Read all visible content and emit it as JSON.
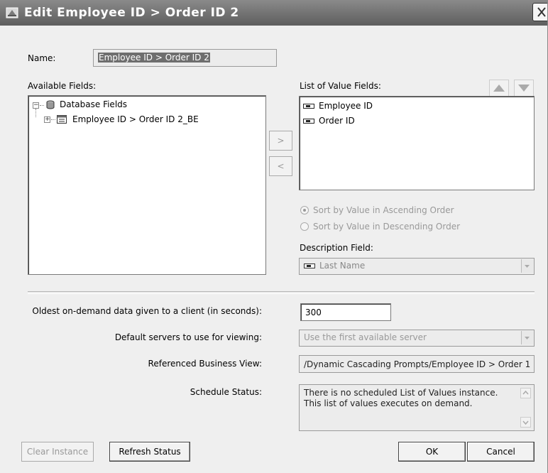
{
  "window": {
    "title": "Edit Employee ID > Order ID 2"
  },
  "name_label": "Name:",
  "name_value": "Employee ID > Order ID 2",
  "available_fields": {
    "label": "Available Fields:",
    "tree": [
      {
        "label": "Database Fields",
        "icon": "database-icon",
        "expander": "−"
      },
      {
        "label": "Employee ID > Order ID 2_BE",
        "icon": "table-icon",
        "expander": "+"
      }
    ]
  },
  "move_buttons": {
    "add": ">",
    "remove": "<"
  },
  "value_fields": {
    "label": "List of Value Fields:",
    "items": [
      "Employee ID",
      "Order ID"
    ],
    "up_icon": "arrow-up-icon",
    "down_icon": "arrow-down-icon"
  },
  "sort": {
    "ascending": "Sort by Value in Ascending Order",
    "descending": "Sort by Value in Descending Order",
    "selected": "ascending"
  },
  "description": {
    "label": "Description Field:",
    "value": "Last Name"
  },
  "settings": {
    "oldest_label": "Oldest on-demand data given to a client (in seconds):",
    "oldest_value": "300",
    "servers_label": "Default servers to use for viewing:",
    "servers_value": "Use the first available server",
    "business_view_label": "Referenced Business View:",
    "business_view_value": "/Dynamic Cascading Prompts/Employee ID > Order 1",
    "schedule_label": "Schedule Status:",
    "schedule_value": "There is no scheduled List of Values instance. This list of values executes on demand."
  },
  "buttons": {
    "clear_instance": "Clear Instance",
    "refresh_status": "Refresh Status",
    "ok": "OK",
    "cancel": "Cancel"
  },
  "colors": {
    "titlebar_start": "#8a8a8a",
    "titlebar_end": "#5e5e5e",
    "dialog_bg": "#efefef",
    "disabled_text": "#999999"
  }
}
